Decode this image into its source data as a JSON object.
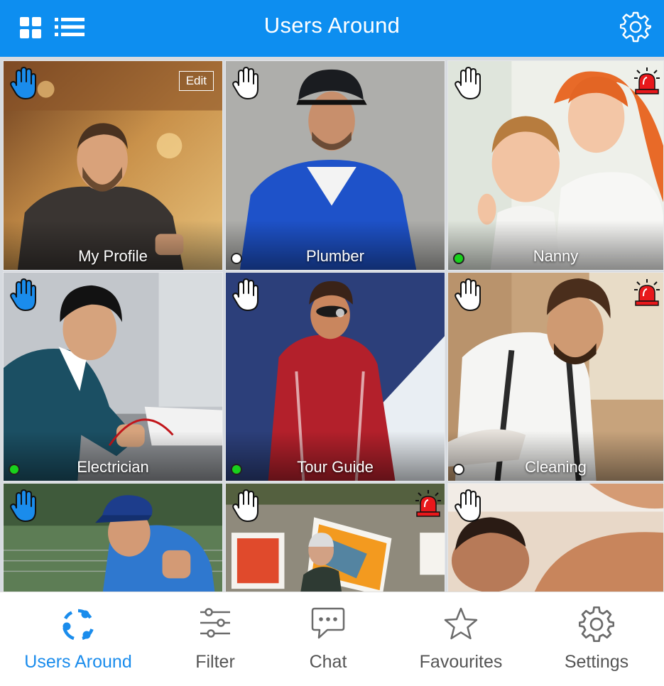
{
  "header": {
    "title": "Users Around",
    "icons": [
      "grid-view-icon",
      "list-view-icon",
      "gear-icon"
    ]
  },
  "colors": {
    "brand": "#0d8ef0",
    "online": "#19d11c",
    "alarm": "#e8181b",
    "hand_active": "#1a8cec"
  },
  "tiles": [
    {
      "label": "My Profile",
      "edit_label": "Edit"
    },
    {
      "label": "Plumber",
      "status": "offline"
    },
    {
      "label": "Nanny",
      "status": "online",
      "alarm": true
    },
    {
      "label": "Electrician",
      "status": "online"
    },
    {
      "label": "Tour Guide",
      "status": "online"
    },
    {
      "label": "Cleaning",
      "status": "offline",
      "alarm": true
    },
    {
      "label": ""
    },
    {
      "label": "",
      "alarm": true
    },
    {
      "label": ""
    }
  ],
  "nav": {
    "items": [
      {
        "label": "Users Around",
        "icon": "users-around-icon",
        "active": true
      },
      {
        "label": "Filter",
        "icon": "sliders-icon"
      },
      {
        "label": "Chat",
        "icon": "chat-bubble-icon"
      },
      {
        "label": "Favourites",
        "icon": "star-icon"
      },
      {
        "label": "Settings",
        "icon": "gear-icon"
      }
    ]
  }
}
